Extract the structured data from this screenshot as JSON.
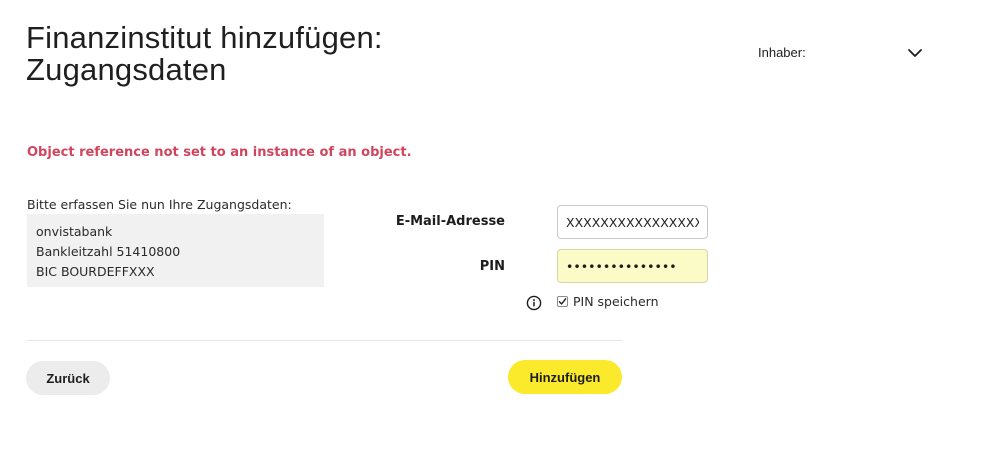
{
  "header": {
    "title_line1": "Finanzinstitut hinzufügen:",
    "title_line2": "Zugangsdaten",
    "owner_label": "Inhaber:",
    "owner_icon": "chevron-down-icon"
  },
  "error": {
    "message": "Object reference not set to an instance of an object.",
    "color": "#d0455e"
  },
  "bank": {
    "intro": "Bitte erfassen Sie nun Ihre Zugangsdaten:",
    "name": "onvistabank",
    "bankleitzahl": "Bankleitzahl 51410800",
    "bic": "BIC BOURDEFFXXX"
  },
  "form": {
    "email_label": "E-Mail-Adresse",
    "email_value": "XXXXXXXXXXXXXXXXXXXX",
    "pin_label": "PIN",
    "pin_value": "•••••••••••••••",
    "save_pin_label": "PIN speichern",
    "save_pin_checked": true,
    "info_icon": "info-icon"
  },
  "actions": {
    "back_label": "Zurück",
    "add_label": "Hinzufügen",
    "accent_color": "#fbea2b"
  }
}
